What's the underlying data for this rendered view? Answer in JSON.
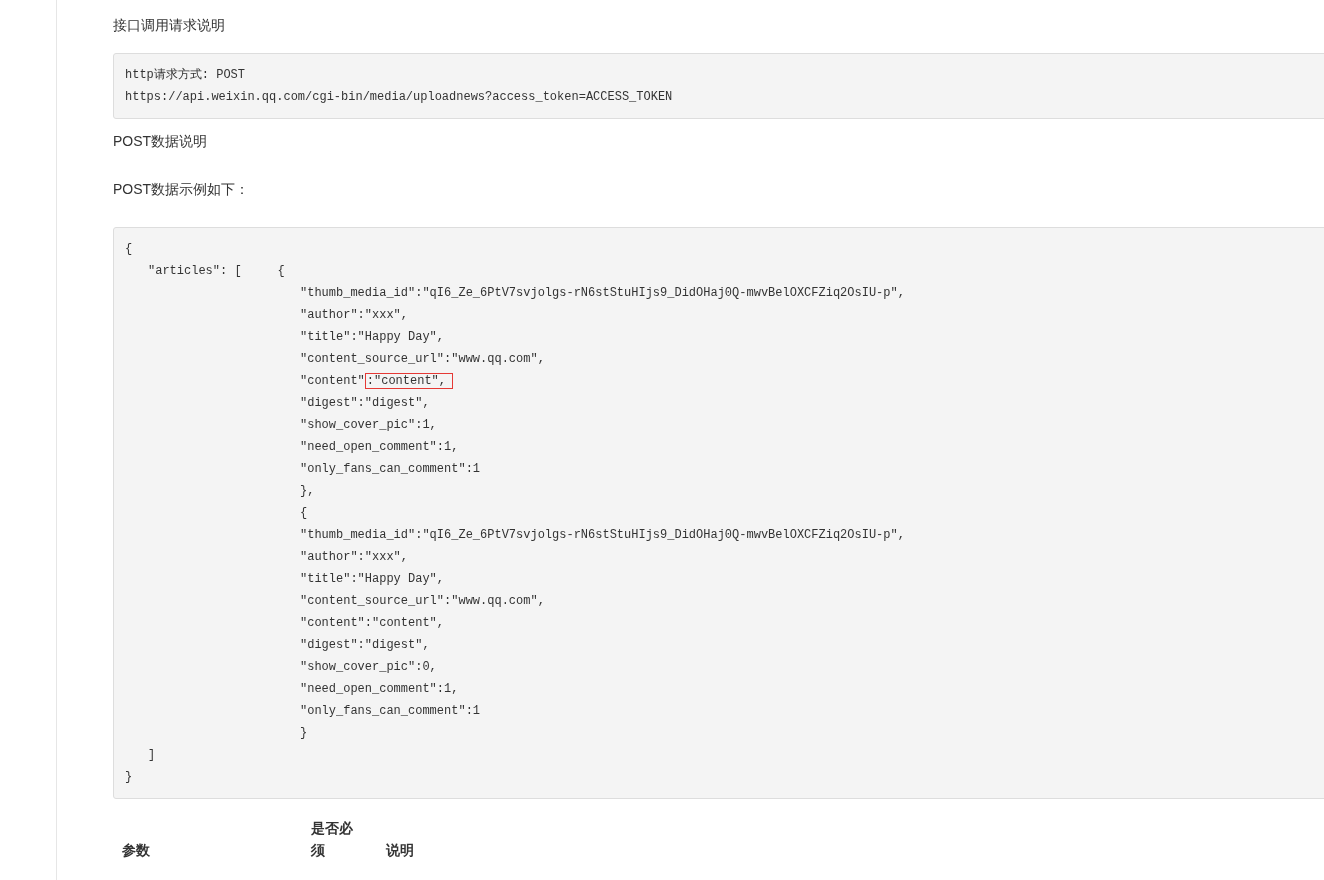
{
  "heading": "接口调用请求说明",
  "request_code": [
    {
      "text": "http请求方式: POST"
    },
    {
      "text": "https://api.weixin.qq.com/cgi-bin/media/uploadnews?access_token=ACCESS_TOKEN"
    }
  ],
  "post_data_heading": "POST数据说明",
  "example_heading": "POST数据示例如下：",
  "example_code": [
    {
      "kind": "root",
      "text": "{"
    },
    {
      "kind": "key",
      "text": "\"articles\": [     {"
    },
    {
      "kind": "item",
      "text": "\"thumb_media_id\":\"qI6_Ze_6PtV7svjolgs-rN6stStuHIjs9_DidOHaj0Q-mwvBelOXCFZiq2OsIU-p\","
    },
    {
      "kind": "item",
      "text": "\"author\":\"xxx\","
    },
    {
      "kind": "item",
      "text": "\"title\":\"Happy Day\","
    },
    {
      "kind": "item",
      "text": "\"content_source_url\":\"www.qq.com\","
    },
    {
      "kind": "item",
      "text": "\"content\"",
      "highlight": ":\"content\","
    },
    {
      "kind": "item",
      "text": "\"digest\":\"digest\","
    },
    {
      "kind": "item",
      "text": "\"show_cover_pic\":1,"
    },
    {
      "kind": "item",
      "text": "\"need_open_comment\":1,"
    },
    {
      "kind": "item",
      "text": "\"only_fans_can_comment\":1"
    },
    {
      "kind": "item",
      "text": "},"
    },
    {
      "kind": "item",
      "text": "{"
    },
    {
      "kind": "item",
      "text": "\"thumb_media_id\":\"qI6_Ze_6PtV7svjolgs-rN6stStuHIjs9_DidOHaj0Q-mwvBelOXCFZiq2OsIU-p\","
    },
    {
      "kind": "item",
      "text": "\"author\":\"xxx\","
    },
    {
      "kind": "item",
      "text": "\"title\":\"Happy Day\","
    },
    {
      "kind": "item",
      "text": "\"content_source_url\":\"www.qq.com\","
    },
    {
      "kind": "item",
      "text": "\"content\":\"content\","
    },
    {
      "kind": "item",
      "text": "\"digest\":\"digest\","
    },
    {
      "kind": "item",
      "text": "\"show_cover_pic\":0,"
    },
    {
      "kind": "item",
      "text": "\"need_open_comment\":1,"
    },
    {
      "kind": "item",
      "text": "\"only_fans_can_comment\":1"
    },
    {
      "kind": "item",
      "text": "}"
    },
    {
      "kind": "key",
      "text": "]"
    },
    {
      "kind": "root",
      "text": "}"
    }
  ],
  "table": {
    "columns": [
      "参数",
      "是否必须",
      "说明"
    ]
  }
}
